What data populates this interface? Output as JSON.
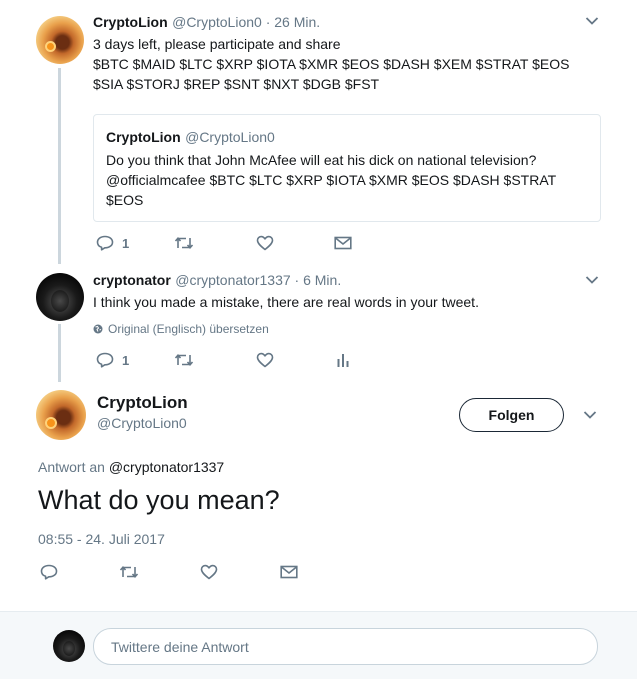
{
  "tweet1": {
    "name": "CryptoLion",
    "handle": "@CryptoLion0",
    "time": " · 26 Min.",
    "lines": [
      "3 days left, please participate and share",
      "$BTC $MAID $LTC $XRP $IOTA $XMR $EOS $DASH $XEM $STRAT $EOS",
      "$SIA $STORJ $REP $SNT $NXT $DGB $FST"
    ],
    "quote": {
      "name": "CryptoLion",
      "handle": "@CryptoLion0",
      "lines": [
        "Do you think that John McAfee will eat his dick on national television?",
        "@officialmcafee $BTC $LTC $XRP $IOTA $XMR $EOS $DASH $STRAT",
        "$EOS"
      ]
    },
    "reply_count": "1"
  },
  "tweet2": {
    "name": "cryptonator",
    "handle": "@cryptonator1337",
    "time": " · 6 Min.",
    "text": "I think you made a mistake, there are real words in your tweet.",
    "translate": "Original (Englisch) übersetzen",
    "reply_count": "1"
  },
  "main_tweet": {
    "name": "CryptoLion",
    "handle": "@CryptoLion0",
    "follow_label": "Folgen",
    "reply_to_prefix": "Antwort an ",
    "reply_to_handle": "@cryptonator1337",
    "text": "What do you mean?",
    "timestamp": "08:55 - 24. Juli 2017"
  },
  "reply_box": {
    "placeholder": "Twittere deine Antwort"
  },
  "icons": {
    "reply": "reply-icon",
    "retweet": "retweet-icon",
    "like": "heart-icon",
    "dm": "envelope-icon",
    "analytics": "analytics-icon",
    "globe": "globe-icon",
    "chevron": "chevron-down-icon"
  },
  "colors": {
    "secondary_text": "#657786",
    "thread_line": "#ccd6dd",
    "border": "#e1e8ed",
    "reply_bar_bg": "#f5f8fa"
  }
}
